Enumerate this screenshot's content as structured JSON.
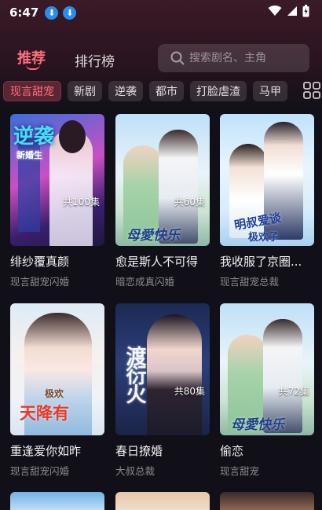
{
  "status": {
    "time": "6:47",
    "download_glyph": "⬇"
  },
  "tabs": {
    "recommend": "推荐",
    "ranking": "排行榜"
  },
  "search": {
    "placeholder": "搜索剧名、主角"
  },
  "chips": [
    "现言甜宠",
    "新剧",
    "逆袭",
    "都市",
    "打脸虐渣",
    "马甲"
  ],
  "cards": [
    {
      "title": "绯纱覆真颜",
      "subtitle": "现言甜宠闪婚",
      "episodes": "共100集",
      "cover_text": "逆袭",
      "cover_sub": "新婚生"
    },
    {
      "title": "愈是斯人不可得",
      "subtitle": "暗恋成真闪婚",
      "episodes": "共60集",
      "cover_text": "母愛快乐",
      "cover_sub": ""
    },
    {
      "title": "我收服了京圈...",
      "subtitle": "现言甜宠总裁",
      "episodes": "",
      "cover_text": "明叔爱谈",
      "cover_sub": "极欢子"
    },
    {
      "title": "重逢爱你如昨",
      "subtitle": "现言甜宠闪婚",
      "episodes": "",
      "cover_text": "天降有",
      "cover_sub": "极欢"
    },
    {
      "title": "春日撩婚",
      "subtitle": "大叔总裁",
      "episodes": "共80集",
      "cover_text": "渡衍火",
      "cover_sub": ""
    },
    {
      "title": "偷恋",
      "subtitle": "现言甜宠",
      "episodes": "共72集",
      "cover_text": "母愛快乐",
      "cover_sub": ""
    }
  ],
  "colors": {
    "accent": "#ff6f7d",
    "background": "#111018"
  }
}
